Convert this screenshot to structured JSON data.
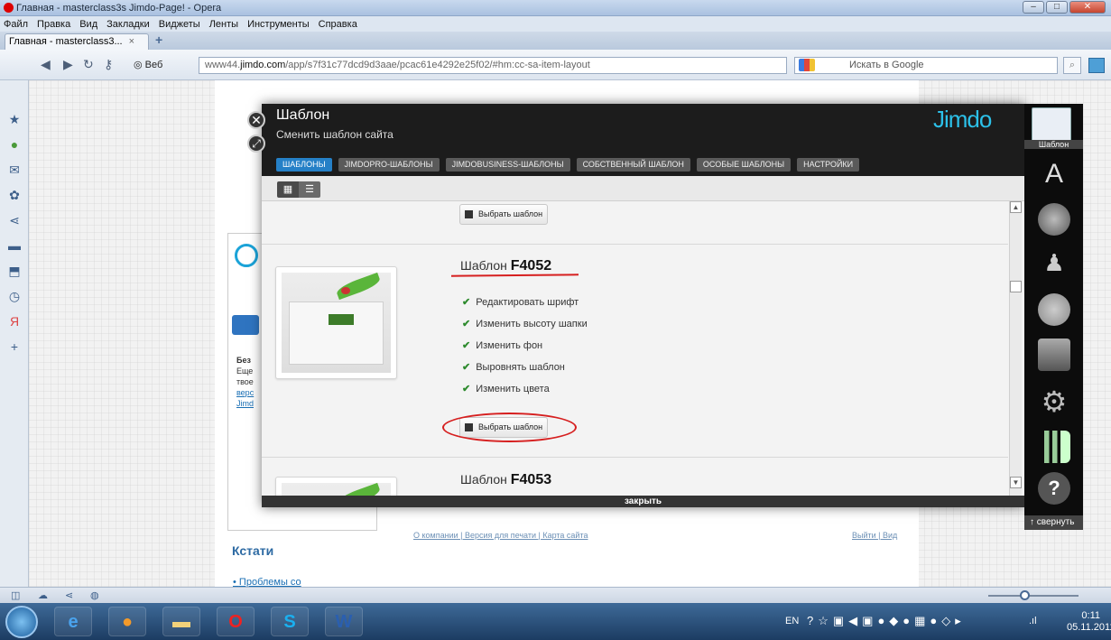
{
  "window": {
    "title": "Главная - masterclass3s Jimdo-Page! - Opera",
    "controls": [
      "–",
      "□",
      "✕"
    ]
  },
  "menu": [
    "Файл",
    "Правка",
    "Вид",
    "Закладки",
    "Виджеты",
    "Ленты",
    "Инструменты",
    "Справка"
  ],
  "tabs": [
    {
      "label": "Главная - masterclass3...",
      "close": "×"
    }
  ],
  "newtab": "+",
  "address": {
    "web_label": "Веб",
    "url_prefix": "www44.",
    "url_domain": "jimdo.com",
    "url_rest": "/app/s7f31c77dcd9d3aae/pcac61e4292e25f02/#hm:cc-sa-item-layout",
    "search_placeholder": "Искать в Google"
  },
  "page": {
    "sidebar_heading": "Кстати",
    "sidebar_link": "Проблемы со",
    "frag_bold": "Без",
    "frag_lines": [
      "Еще",
      "твое"
    ],
    "frag_links": [
      "верс",
      "Jimd"
    ],
    "footer_links": "О компании | Версия для печати | Карта сайта",
    "footer_right": "Выйти | Вид"
  },
  "modal": {
    "title": "Шаблон",
    "subtitle": "Сменить шаблон сайта",
    "logo": "Jimdo",
    "tabs": [
      "Шаблоны",
      "JimdoPro-шаблоны",
      "JimdoBusiness-шаблоны",
      "Собственный шаблон",
      "Особые шаблоны",
      "Настройки"
    ],
    "select_label": "Выбрать шаблон",
    "template_prefix": "Шаблон",
    "templates": [
      {
        "code": "F4052",
        "features": [
          "Редактировать шрифт",
          "Изменить высоту шапки",
          "Изменить фон",
          "Выровнять шаблон",
          "Изменить цвета"
        ]
      },
      {
        "code": "F4053"
      }
    ],
    "close_label": "закрыть"
  },
  "rightbar": {
    "active_label": "Шаблон",
    "collapse_label": "свернуть"
  },
  "tray": {
    "lang": "EN",
    "time": "0:11",
    "date": "05.11.2011"
  }
}
